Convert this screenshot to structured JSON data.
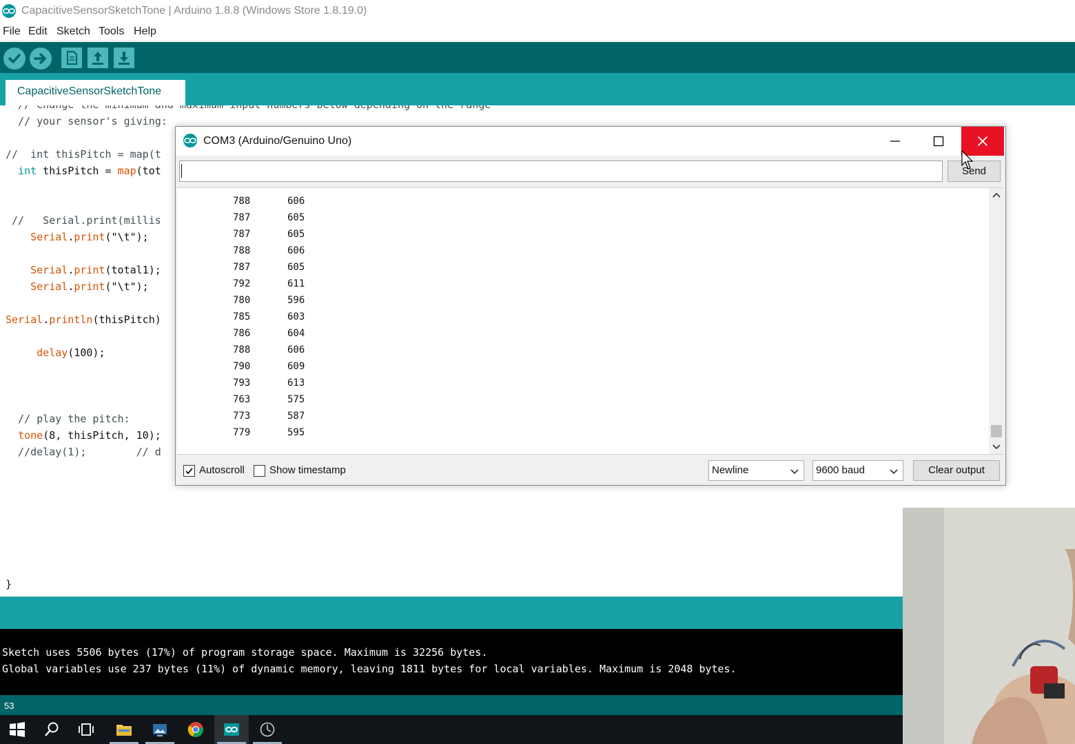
{
  "window": {
    "title": "CapacitiveSensorSketchTone | Arduino 1.8.8 (Windows Store 1.8.19.0)"
  },
  "menu": [
    "File",
    "Edit",
    "Sketch",
    "Tools",
    "Help"
  ],
  "toolbar": {
    "buttons": [
      "verify-icon",
      "upload-icon",
      "new-icon",
      "open-icon",
      "save-icon"
    ]
  },
  "tab": {
    "label": "CapacitiveSensorSketchTone"
  },
  "code_lines": [
    "  // change the minimum and maximum input numbers below depending on the range",
    "  // your sensor's giving:",
    "",
    "//  int thisPitch = map(t",
    "  int thisPitch = map(tot",
    "",
    "",
    " //   Serial.print(millis",
    "    Serial.print(\"\\t\");",
    "",
    "    Serial.print(total1);",
    "    Serial.print(\"\\t\");",
    "",
    "Serial.println(thisPitch)",
    "",
    "     delay(100);",
    "",
    "",
    "",
    "  // play the pitch:",
    "  tone(8, thisPitch, 10);",
    "  //delay(1);        // d",
    "",
    "",
    "",
    "",
    "",
    "",
    "}"
  ],
  "console": {
    "lines": [
      "Sketch uses 5506 bytes (17%) of program storage space. Maximum is 32256 bytes.",
      "Global variables use 237 bytes (11%) of dynamic memory, leaving 1811 bytes for local variables. Maximum is 2048 bytes."
    ],
    "line_number": "53"
  },
  "serial_monitor": {
    "title": "COM3 (Arduino/Genuino Uno)",
    "input_value": "",
    "send_label": "Send",
    "output": [
      [
        "788",
        "606"
      ],
      [
        "787",
        "605"
      ],
      [
        "787",
        "605"
      ],
      [
        "788",
        "606"
      ],
      [
        "787",
        "605"
      ],
      [
        "792",
        "611"
      ],
      [
        "780",
        "596"
      ],
      [
        "785",
        "603"
      ],
      [
        "786",
        "604"
      ],
      [
        "788",
        "606"
      ],
      [
        "790",
        "609"
      ],
      [
        "793",
        "613"
      ],
      [
        "763",
        "575"
      ],
      [
        "773",
        "587"
      ],
      [
        "779",
        "595"
      ]
    ],
    "autoscroll": {
      "label": "Autoscroll",
      "checked": true
    },
    "timestamp": {
      "label": "Show timestamp",
      "checked": false
    },
    "line_ending": "Newline",
    "baud": "9600 baud",
    "clear_label": "Clear output"
  },
  "taskbar": {
    "items": [
      "windows-start-icon",
      "search-icon",
      "task-view-icon",
      "file-explorer-icon",
      "photos-app-icon",
      "chrome-icon",
      "arduino-app-icon",
      "clock-app-icon"
    ]
  },
  "colors": {
    "arduino_teal_dark": "#006468",
    "arduino_teal": "#17a1a5",
    "arduino_button": "#4db7bb",
    "close_red": "#e81123"
  }
}
